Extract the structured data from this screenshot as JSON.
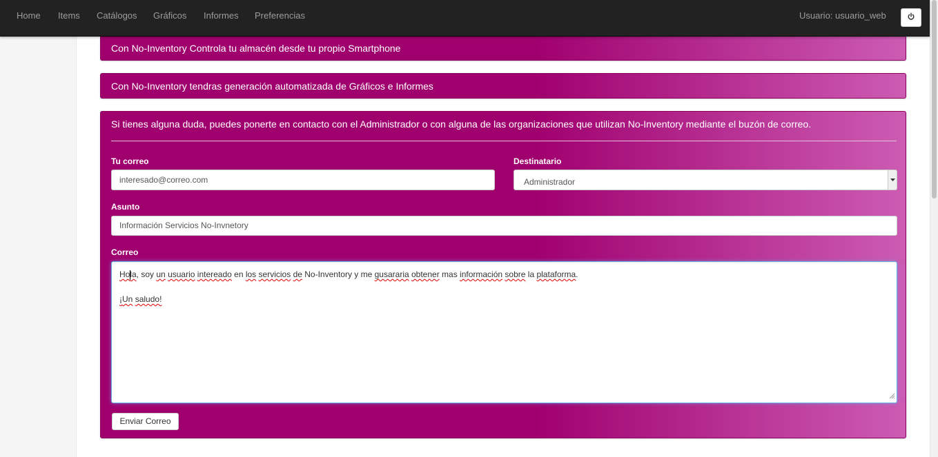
{
  "nav": {
    "items": [
      {
        "label": "Home"
      },
      {
        "label": "Items"
      },
      {
        "label": "Catálogos"
      },
      {
        "label": "Gráficos"
      },
      {
        "label": "Informes"
      },
      {
        "label": "Preferencias"
      }
    ],
    "user_label": "Usuario: usuario_web",
    "power_icon": "power-icon"
  },
  "panels": {
    "smartphone": "Con No-Inventory Controla tu almacén desde tu propio Smartphone",
    "reports": "Con No-Inventory tendras generación automatizada de Gráficos e Informes",
    "contact_intro": "Si tienes alguna duda, puedes ponerte en contacto con el Administrador o con alguna de las organizaciones que utilizan No-Inventory mediante el buzón de correo."
  },
  "form": {
    "email_label": "Tu correo",
    "email_value": "interesado@correo.com",
    "recipient_label": "Destinatario",
    "recipient_value": "Administrador",
    "subject_label": "Asunto",
    "subject_value": "Información Servicios No-Invnetory",
    "body_label": "Correo",
    "body_lines": {
      "line1": {
        "w01": "Hola",
        "w02": ", soy ",
        "w03": "un",
        "w04": " ",
        "w05": "usuario",
        "w06": " ",
        "w07": "intereado",
        "w08": " en ",
        "w09": "los",
        "w10": " ",
        "w11": "servicios",
        "w12": " ",
        "w13": "de",
        "w14": " No-Inventory y me ",
        "w15": "gusararia",
        "w16": " ",
        "w17": "obtener",
        "w18": " mas ",
        "w19": "información",
        "w20": " ",
        "w21": "sobre",
        "w22": " la ",
        "w23": "plataforma",
        "w24": "."
      },
      "line2": {
        "w01": "¡",
        "w02": "Un",
        "w03": " ",
        "w04": "saludo",
        "w05": "!"
      }
    },
    "submit_label": "Enviar Correo"
  },
  "colors": {
    "navbar": "#222222",
    "panel_primary": "#a0006e",
    "panel_gradient_end": "#cc5cb3",
    "focus_border": "#66afe9"
  }
}
